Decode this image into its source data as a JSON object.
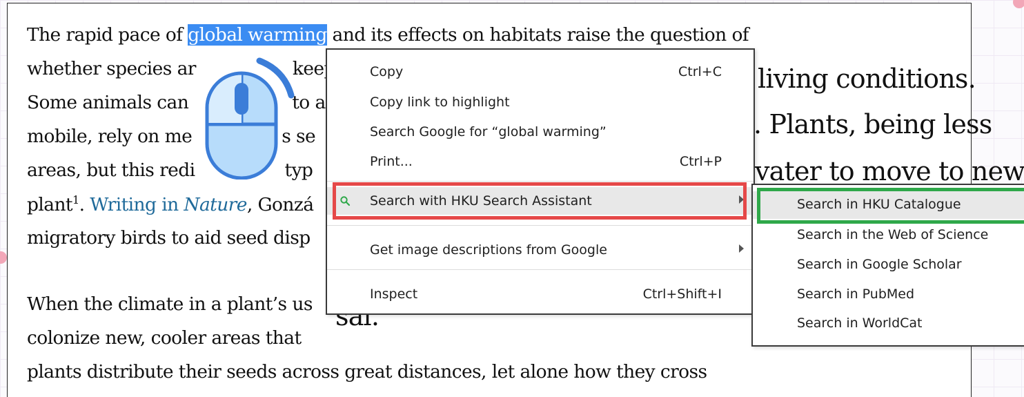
{
  "article": {
    "line1_before": "The rapid pace of ",
    "line1_highlight": "global warming",
    "line1_after": " and its effects on habitats raise the question of",
    "line2": "whether species ar",
    "line2b": "keep",
    "line3": "Some animals can",
    "line3b": "to a",
    "line4": "mobile, rely on me",
    "line4b": "s se",
    "line5": "areas, but this redi",
    "line5b": "typ",
    "line6_before": "plant",
    "line6_sup": "1",
    "line6_dot": ". ",
    "line6_link1": "Writing in ",
    "line6_link_italic": "Nature",
    "line6_after": ", Gonzá",
    "line7": "migratory birds to aid seed disp",
    "line8": "When the climate in a plant’s us",
    "line9": "colonize new, cooler areas that",
    "line10": "plants distribute their seeds across great distances, let alone how they cross"
  },
  "background_text": {
    "t1": "living conditions.",
    "t2": ". Plants, being less",
    "t3": "vater to move to new",
    "t4": "sal."
  },
  "context_menu": {
    "copy": "Copy",
    "copy_shortcut": "Ctrl+C",
    "copy_link": "Copy link to highlight",
    "search_google": "Search Google for “global warming”",
    "print": "Print...",
    "print_shortcut": "Ctrl+P",
    "hku_search": "Search with HKU Search Assistant",
    "image_desc": "Get image descriptions from Google",
    "inspect": "Inspect",
    "inspect_shortcut": "Ctrl+Shift+I"
  },
  "submenu": {
    "items": [
      "Search in HKU Catalogue",
      "Search in the Web of Science",
      "Search in Google Scholar",
      "Search in PubMed",
      "Search in WorldCat"
    ]
  },
  "colors": {
    "highlight": "#3b8cf2",
    "link": "#1f6a9a",
    "red_outline": "#e54848",
    "green_outline": "#2fa84a",
    "mouse_fill": "#b7dcfb",
    "mouse_stroke": "#3b7dd8"
  },
  "icons": {
    "mouse": "mouse-click-icon",
    "search": "search-icon",
    "submenu_arrow": "chevron-right-icon"
  }
}
